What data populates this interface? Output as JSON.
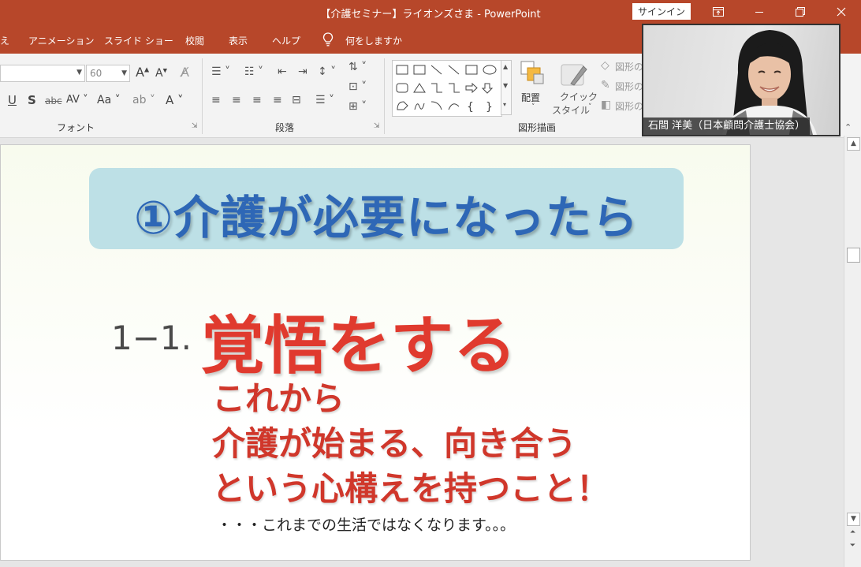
{
  "window": {
    "title": "【介護セミナー】ライオンズさま  -  PowerPoint",
    "signin_label": "サインイン"
  },
  "tabs": [
    {
      "label": "え"
    },
    {
      "label": "アニメーション"
    },
    {
      "label": "スライド ショー"
    },
    {
      "label": "校閲"
    },
    {
      "label": "表示"
    },
    {
      "label": "ヘルプ"
    },
    {
      "label": "何をしますか"
    }
  ],
  "ribbon": {
    "font_size": "60",
    "groups": {
      "font": "フォント",
      "paragraph": "段落",
      "drawing": "図形描画"
    },
    "arrange_label": "配置",
    "quick_style_label_1": "クイック",
    "quick_style_label_2": "スタイル",
    "shape_fill": "図形の",
    "shape_outline": "図形の",
    "shape_effect": "図形の"
  },
  "slide": {
    "heading": "①介護が必要になったら",
    "item_number": "1−1.",
    "item_title": "覚悟をする",
    "lines": [
      "これから",
      "介護が始まる、向き合う",
      "という心構えを持つこと！"
    ],
    "note": "・・・これまでの生活ではなくなります。。。"
  },
  "webcam": {
    "participant": "石間 洋美（日本顧問介護士協会）"
  }
}
